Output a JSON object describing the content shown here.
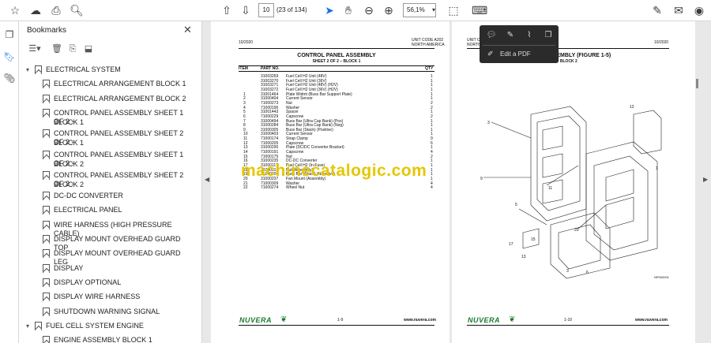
{
  "toolbar": {
    "page_current": "10",
    "page_count": "(23 of 134)",
    "zoom": "56,1%"
  },
  "bookmarks": {
    "title": "Bookmarks",
    "items": [
      {
        "label": "ELECTRICAL SYSTEM",
        "level": 0,
        "expanded": true
      },
      {
        "label": "ELECTRICAL ARRANGEMENT BLOCK 1",
        "level": 1
      },
      {
        "label": "ELECTRICAL ARRANGEMENT BLOCK 2",
        "level": 1
      },
      {
        "label": "CONTROL PANEL ASSEMBLY SHEET 1 OF 2 -",
        "label2": "BLOCK 1",
        "level": 1
      },
      {
        "label": "CONTROL PANEL ASSEMBLY SHEET 2 OF 2 -",
        "label2": "BLOCK 1",
        "level": 1
      },
      {
        "label": "CONTROL PANEL ASSEMBLY SHEET 1 OF 2 -",
        "label2": "BLOCK 2",
        "level": 1
      },
      {
        "label": "CONTROL PANEL ASSEMBLY SHEET 2 OF 2 -",
        "label2": "BLOCK 2",
        "level": 1
      },
      {
        "label": "DC-DC CONVERTER",
        "level": 1
      },
      {
        "label": "ELECTRICAL PANEL",
        "level": 1
      },
      {
        "label": "WIRE HARNESS (HIGH PRESSURE CABLE)",
        "level": 1
      },
      {
        "label": "DISPLAY MOUNT OVERHEAD GUARD TOP",
        "level": 1
      },
      {
        "label": "DISPLAY MOUNT OVERHEAD GUARD LEG",
        "level": 1
      },
      {
        "label": "DISPLAY",
        "level": 1
      },
      {
        "label": "DISPLAY OPTIONAL",
        "level": 1
      },
      {
        "label": "DISPLAY WIRE HARNESS",
        "level": 1
      },
      {
        "label": "SHUTDOWN WARNING SIGNAL",
        "level": 1
      },
      {
        "label": "FUEL CELL SYSTEM ENGINE",
        "level": 0,
        "expanded": true
      },
      {
        "label": "ENGINE ASSEMBLY BLOCK 1",
        "level": 1
      }
    ]
  },
  "left_page": {
    "date": "10/2020",
    "unit_code": "UNIT CODE A202",
    "region": "NORTH AMERICA",
    "title": "CONTROL PANEL ASSEMBLY",
    "subtitle": "SHEET 2 OF 2 – BLOCK 1",
    "headers": {
      "item": "ITEM",
      "part": "PART NO.",
      "desc": "DESCRIPTION",
      "qty": "QTY"
    },
    "rows": [
      {
        "item": "",
        "part": "31003269",
        "desc": "Fuel Cell H2 Unit (48V)",
        "qty": "1"
      },
      {
        "item": "",
        "part": "31003270",
        "desc": "Fuel Cell H2 Unit (36V)",
        "qty": "1"
      },
      {
        "item": "",
        "part": "31003271",
        "desc": "Fuel Cell H2 Unit (48V) (H2V)",
        "qty": "1"
      },
      {
        "item": "",
        "part": "31003272",
        "desc": "Fuel Cell H2 Unit (36V) (H2V)",
        "qty": "1"
      },
      {
        "item": "1",
        "part": "31001464",
        "desc": "Plate Widmt (Buss Bar Support Plate)",
        "qty": "1"
      },
      {
        "item": "2",
        "part": "31000404",
        "desc": "Current Sensor",
        "qty": "1"
      },
      {
        "item": "3",
        "part": "71000273",
        "desc": "Nut",
        "qty": "2"
      },
      {
        "item": "4",
        "part": "71000196",
        "desc": "Washer",
        "qty": "2"
      },
      {
        "item": "5",
        "part": "31001443",
        "desc": "Spacer",
        "qty": "1"
      },
      {
        "item": "6",
        "part": "71000229",
        "desc": "Capscrew",
        "qty": "2"
      },
      {
        "item": "7",
        "part": "31000494",
        "desc": "Buss Bar (Ultra Cap Bank) (Pos)",
        "qty": "1"
      },
      {
        "item": "8",
        "part": "31000284",
        "desc": "Buss Bar (Ultra Cap Bank) (Neg)",
        "qty": "1"
      },
      {
        "item": "9",
        "part": "31000305",
        "desc": "Buss Bar (Stack) (Positive)",
        "qty": "1"
      },
      {
        "item": "10",
        "part": "31000403",
        "desc": "Current Sensor",
        "qty": "1"
      },
      {
        "item": "11",
        "part": "71000174",
        "desc": "Strap Clamp",
        "qty": "9"
      },
      {
        "item": "12",
        "part": "71000205",
        "desc": "Capscrew",
        "qty": "6"
      },
      {
        "item": "13",
        "part": "31000295",
        "desc": "Plate (DC/DC Converter Bracket)",
        "qty": "1"
      },
      {
        "item": "14",
        "part": "71000191",
        "desc": "Capscrew",
        "qty": "4"
      },
      {
        "item": "15",
        "part": "71000175",
        "desc": "Nut",
        "qty": "2"
      },
      {
        "item": "16",
        "part": "31000235",
        "desc": "DC-DC Converter",
        "qty": "1"
      },
      {
        "item": "17",
        "part": "31000117",
        "desc": "Fuel Cell H2 (In-Fuse)",
        "qty": "1"
      },
      {
        "item": "18",
        "part": "71000311",
        "desc": "Nut (Assembly)",
        "qty": "1"
      },
      {
        "item": "19",
        "part": "31000306",
        "desc": "Buss Bar (Stack) (Negative)",
        "qty": "1"
      },
      {
        "item": "20",
        "part": "31000237",
        "desc": "Fan Mount (Assembly)",
        "qty": "1"
      },
      {
        "item": "21",
        "part": "71000309",
        "desc": "Washer",
        "qty": "4"
      },
      {
        "item": "22",
        "part": "71000274",
        "desc": "Wheel Nut",
        "qty": "4"
      }
    ],
    "footer_logo": "NUVERA",
    "page_no": "1-9",
    "url": "www.nuvera.com"
  },
  "right_page": {
    "unit_code": "UNIT CODE A202",
    "region": "NORTH AMERICA",
    "date": "10/2020",
    "title": "ASSEMBLY (FIGURE 1-5)",
    "subtitle": "OF 2 — BLOCK 2",
    "footer_logo": "NUVERA",
    "page_no": "1-10",
    "url": "www.nuvera.com",
    "figure_id": "NP000001"
  },
  "watermark": "machinecatalogic.com",
  "popup": {
    "edit_label": "Edit a PDF"
  }
}
